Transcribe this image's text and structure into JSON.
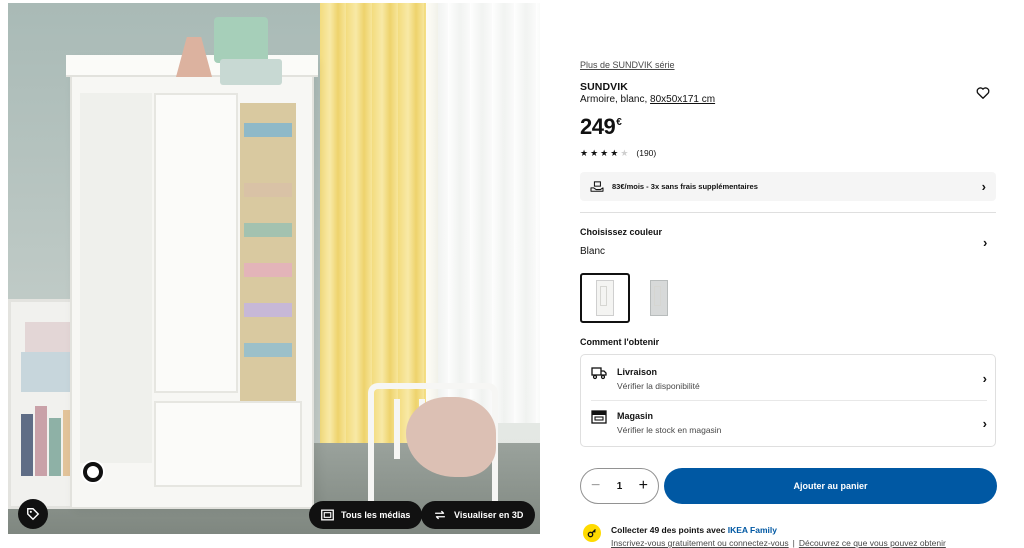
{
  "media": {
    "buttons": {
      "all_media": "Tous les médias",
      "view_3d": "Visualiser en 3D"
    }
  },
  "product": {
    "series_link": "Plus de SUNDVIK série",
    "name": "SUNDVIK",
    "description": "Armoire, blanc, ",
    "dimensions": "80x50x171 cm",
    "price": "249",
    "currency": "€",
    "rating": {
      "value": 4,
      "max": 5,
      "count": "(190)"
    },
    "installment": "83€/mois - 3x sans frais supplémentaires"
  },
  "color": {
    "title": "Choisissez couleur",
    "selected": "Blanc"
  },
  "delivery": {
    "title": "Comment l'obtenir",
    "rows": [
      {
        "title": "Livraison",
        "subtitle": "Vérifier la disponibilité",
        "icon": "truck-icon"
      },
      {
        "title": "Magasin",
        "subtitle": "Vérifier le stock en magasin",
        "icon": "store-icon"
      }
    ]
  },
  "cart": {
    "quantity": "1",
    "minus": "−",
    "plus": "+",
    "add_label": "Ajouter au panier"
  },
  "family": {
    "prefix": "Collecter 49 des points avec ",
    "brand": "IKEA Family",
    "link1": "Inscrivez-vous gratuitement ou connectez-vous",
    "separator": "|",
    "link2": "Découvrez ce que vous pouvez obtenir"
  },
  "colors": {
    "primary_blue": "#0058a3",
    "family_yellow": "#ffdb00",
    "text": "#111111"
  }
}
